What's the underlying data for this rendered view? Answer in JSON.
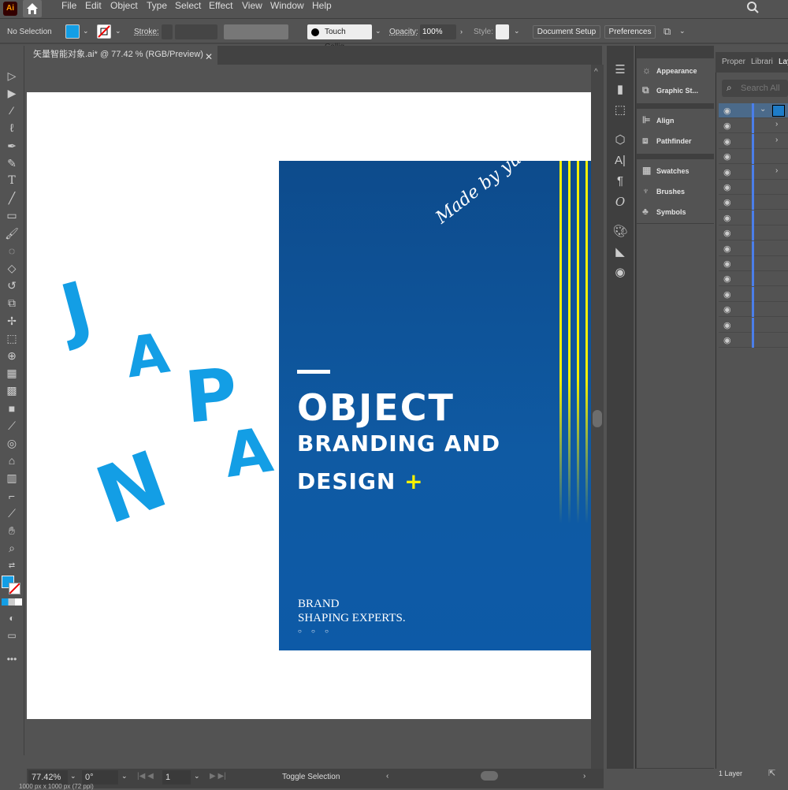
{
  "app": {
    "logo": "Ai",
    "document_tab": "矢量智能对象.ai* @ 77.42 % (RGB/Preview)"
  },
  "menu": [
    "File",
    "Edit",
    "Object",
    "Type",
    "Select",
    "Effect",
    "View",
    "Window",
    "Help"
  ],
  "control_bar": {
    "selection_status": "No Selection",
    "fill_color": "#139ee5",
    "stroke_label": "Stroke:",
    "brush_name": "Touch Callig...",
    "opacity_label": "Opacity:",
    "opacity_value": "100%",
    "style_label": "Style:",
    "document_setup": "Document Setup",
    "preferences": "Preferences"
  },
  "tools": [
    "selection",
    "direct-selection",
    "magic-wand",
    "lasso",
    "pen",
    "curvature",
    "type",
    "line-segment",
    "rectangle",
    "paintbrush",
    "shaper",
    "eraser",
    "rotate",
    "scale",
    "puppet-warp",
    "free-transform",
    "shape-builder",
    "perspective-grid",
    "mesh",
    "gradient",
    "eyedropper",
    "blend",
    "symbol-sprayer",
    "column-graph",
    "artboard",
    "slice",
    "hand",
    "zoom"
  ],
  "artwork": {
    "graffiti_letters": [
      "J",
      "A",
      "P",
      "A",
      "N"
    ],
    "signature": "Made by yuho",
    "headline_1": "OBJECT",
    "headline_2": "BRANDING AND",
    "headline_3": "DESIGN",
    "plus": "+",
    "tagline_1": "BRAND",
    "tagline_2": "SHAPING EXPERTS.",
    "dots": "○ ○ ○",
    "poster_color": "#0f5aa3",
    "accent_yellow": "#f5f000",
    "graffiti_color": "#139ee5"
  },
  "status_bar": {
    "zoom": "77.42%",
    "rotation": "0°",
    "artboard": "1",
    "mode": "Toggle Selection",
    "doc_size": "1000 px x 1000 px (72 ppi)"
  },
  "panels": {
    "groups": [
      [
        "Appearance",
        "Graphic St..."
      ],
      [
        "Align",
        "Pathfinder"
      ],
      [
        "Swatches",
        "Brushes",
        "Symbols"
      ]
    ]
  },
  "layers_panel": {
    "tabs": [
      "Proper",
      "Librari",
      "Lay"
    ],
    "search_placeholder": "Search All",
    "row_count": 16,
    "footer": "1 Layer"
  }
}
